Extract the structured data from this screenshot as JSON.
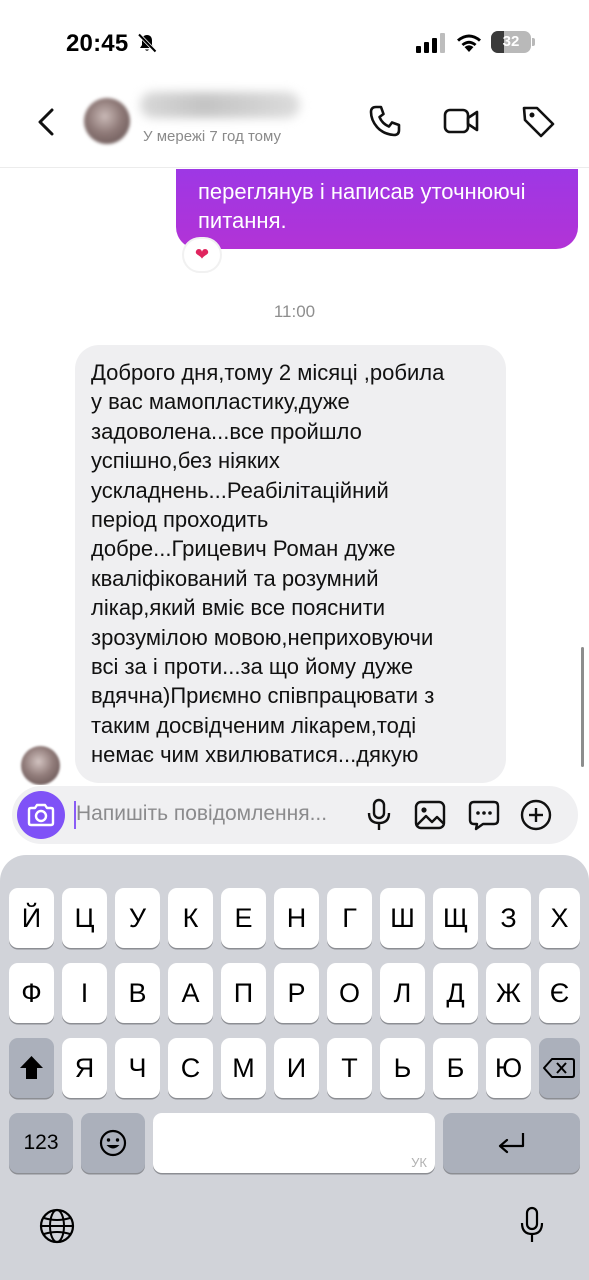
{
  "status_bar": {
    "time": "20:45",
    "battery_percent": "32",
    "battery_level": 0.32
  },
  "header": {
    "presence": "У мережі 7 год тому"
  },
  "chat": {
    "outgoing_partial_text": "переглянув і написав уточнюючі питання.",
    "reaction": "❤",
    "timestamp": "11:00",
    "incoming_text": "Доброго дня,тому 2 місяці ,робила\nу вас мамопластику,дуже\nзадоволена...все пройшло\nуспішно,без ніяких\nускладнень...Реабілітаційний\nперіод проходить\nдобре...Грицевич Роман дуже\nкваліфікований та розумний\nлікар,який вміє все пояснити\nзрозумілою мовою,неприховуючи\nвсі за і проти...за що йому дуже\nвдячна)Приємно співпрацювати з\nтаким досвідченим  лікарем,тоді\nнемає чим хвилюватися...дякую"
  },
  "composer": {
    "placeholder": "Напишіть повідомлення..."
  },
  "keyboard": {
    "row1": [
      "Й",
      "Ц",
      "У",
      "К",
      "Е",
      "Н",
      "Г",
      "Ш",
      "Щ",
      "З",
      "Х"
    ],
    "row2": [
      "Ф",
      "І",
      "В",
      "А",
      "П",
      "Р",
      "О",
      "Л",
      "Д",
      "Ж",
      "Є"
    ],
    "row3": [
      "Я",
      "Ч",
      "С",
      "М",
      "И",
      "Т",
      "Ь",
      "Б",
      "Ю"
    ],
    "numbers_key": "123",
    "space_language": "УК"
  },
  "icons": {
    "bell": "bell-slash-icon",
    "signal": "cellular-signal-icon",
    "wifi": "wifi-icon",
    "back": "chevron-left-icon",
    "call": "phone-icon",
    "video": "video-camera-icon",
    "tag": "tag-icon",
    "camera": "camera-icon",
    "mic": "microphone-icon",
    "image": "image-icon",
    "sticker": "sticker-chat-icon",
    "plus": "plus-circle-icon",
    "shift": "shift-icon",
    "delete": "backspace-icon",
    "emoji": "emoji-icon",
    "return": "return-icon",
    "globe": "globe-icon",
    "dictation": "dictation-icon"
  },
  "colors": {
    "outgoing_bubble": "#a237de",
    "incoming_bubble": "#efeff1",
    "camera_button": "#7f52f7",
    "keyboard_bg": "#d1d3d9"
  }
}
